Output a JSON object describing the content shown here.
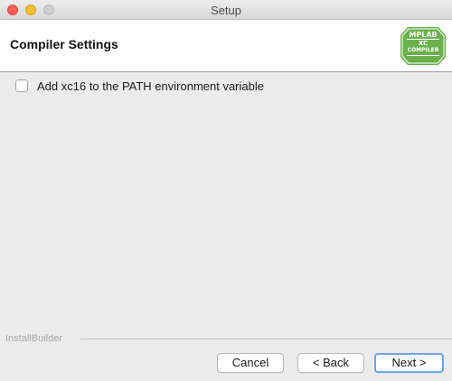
{
  "window": {
    "title": "Setup"
  },
  "header": {
    "title": "Compiler Settings",
    "logo": {
      "icon": "mplab-xc-compiler-logo",
      "line1": "MPLAB",
      "line2": "XC",
      "line3": "COMPILER",
      "color": "#6ab04c"
    }
  },
  "options": {
    "add_path": {
      "label": "Add xc16 to the PATH environment variable",
      "checked": false
    }
  },
  "footer": {
    "brand": "InstallBuilder",
    "cancel_label": "Cancel",
    "back_label": "< Back",
    "next_label": "Next >"
  },
  "colors": {
    "close": "#fc5f57",
    "minimize": "#fdbc2e",
    "maximize": "#d0d0d0",
    "default_button_border": "#6fa3eb"
  }
}
